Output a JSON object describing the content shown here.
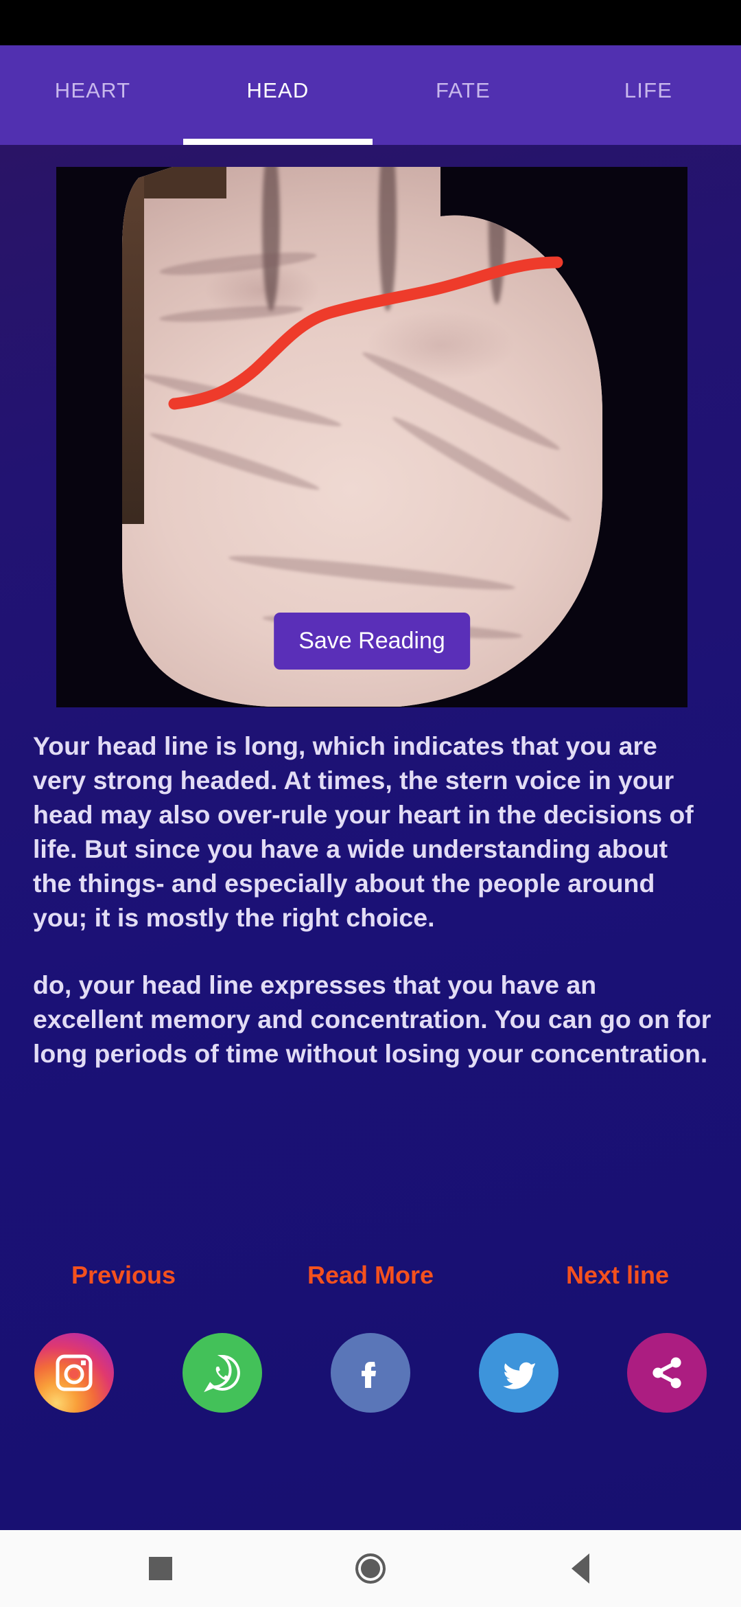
{
  "app": {
    "background_color": "#191070",
    "accent_purple": "#5130B0",
    "link_color": "#F4511E",
    "head_line_color": "#EE3B2B"
  },
  "tabs": [
    {
      "label": "HEART",
      "active": false
    },
    {
      "label": "HEAD",
      "active": true
    },
    {
      "label": "FATE",
      "active": false
    },
    {
      "label": "LIFE",
      "active": false
    }
  ],
  "palm": {
    "image_alt": "palm-photo-with-traced-head-line",
    "save_button_label": "Save Reading"
  },
  "reading": {
    "paragraph1": "Your head line is long, which indicates that you are very strong headed. At times, the stern voice in your head may also over-rule your heart in the decisions of life. But since you have a wide understanding about the things- and especially about the people around you; it is mostly the right choice.",
    "paragraph2": "do, your head line expresses that you have an excellent memory and concentration. You can go on for long periods of time without losing your concentration."
  },
  "actions": {
    "previous": "Previous",
    "read_more": "Read More",
    "next_line": "Next line"
  },
  "social": [
    {
      "name": "instagram-icon",
      "color": "#E0396E"
    },
    {
      "name": "whatsapp-icon",
      "color": "#43C159"
    },
    {
      "name": "facebook-icon",
      "color": "#5A76B8"
    },
    {
      "name": "twitter-icon",
      "color": "#3D94DB"
    },
    {
      "name": "share-icon",
      "color": "#AC1D81"
    }
  ],
  "nav_bar": {
    "recents": "recents-square-icon",
    "home": "home-circle-icon",
    "back": "back-triangle-icon"
  }
}
